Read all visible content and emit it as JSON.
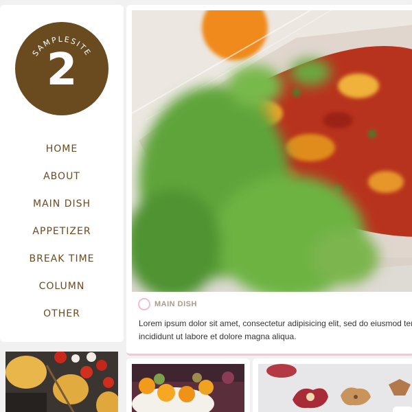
{
  "logo": {
    "brand": "SAMPLESITE",
    "number": "2"
  },
  "nav": [
    "HOME",
    "ABOUT",
    "MAIN DISH",
    "APPETIZER",
    "BREAK TIME",
    "COLUMN",
    "OTHER"
  ],
  "featured": {
    "category": "MAIN DISH",
    "excerpt": "Lorem ipsum dolor sit amet, consectetur adipisicing elit, sed do eiusmod tempor incididunt ut labore et dolore magna aliqua."
  },
  "colors": {
    "brand_brown": "#6a4a1f",
    "accent_pink": "#f4bccd",
    "background": "#f1f1f1"
  }
}
